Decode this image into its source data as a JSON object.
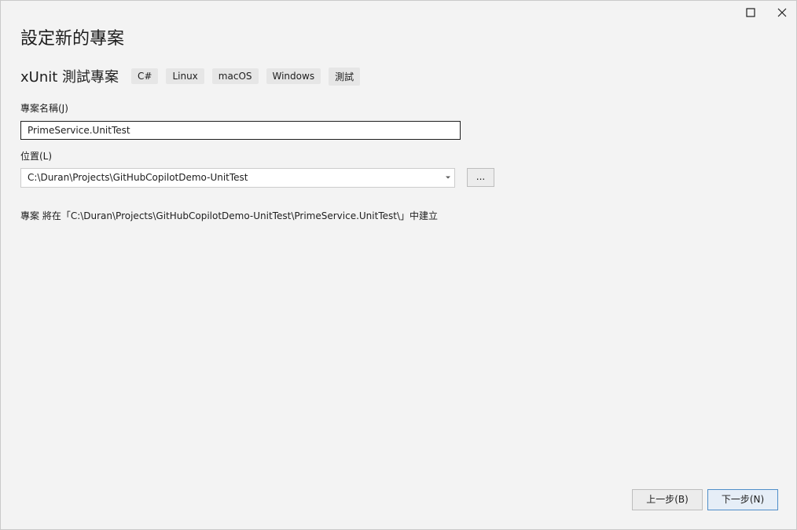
{
  "window": {
    "maximize_icon": "maximize-icon",
    "close_icon": "close-icon"
  },
  "page_title": "設定新的專案",
  "template": {
    "name": "xUnit 測試專案",
    "tags": [
      "C#",
      "Linux",
      "macOS",
      "Windows",
      "測試"
    ]
  },
  "project_name": {
    "label": "專案名稱(J)",
    "value": "PrimeService.UnitTest"
  },
  "location": {
    "label": "位置(L)",
    "value": "C:\\Duran\\Projects\\GitHubCopilotDemo-UnitTest",
    "browse_label": "..."
  },
  "path_note": "專案 將在「C:\\Duran\\Projects\\GitHubCopilotDemo-UnitTest\\PrimeService.UnitTest\\」中建立",
  "buttons": {
    "back": "上一步(B)",
    "next": "下一步(N)"
  },
  "colors": {
    "background": "#f3f3f3",
    "accent_border": "#4f8ec9"
  }
}
